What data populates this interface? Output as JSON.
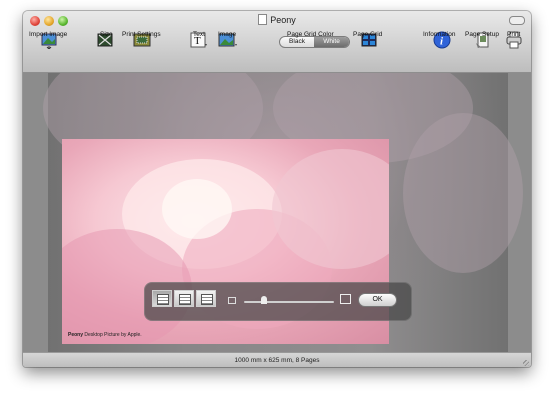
{
  "window": {
    "title": "Peony"
  },
  "toolbar": {
    "import_image": "Import Image",
    "size": "Size",
    "print_settings": "Print Settings",
    "text": "Text",
    "image": "Image",
    "page_grid_color": "Page Grid Color",
    "page_grid_color_options": [
      "Black",
      "White"
    ],
    "page_grid_color_selected": "White",
    "page_grid": "Page Grid",
    "information": "Information",
    "page_setup": "Page Setup",
    "print": "Print"
  },
  "photo": {
    "caption_name": "Peony",
    "caption_text": "Desktop Picture by Apple."
  },
  "hud": {
    "ok_label": "OK",
    "layout_options": [
      "single page",
      "two columns",
      "stacked"
    ],
    "zoom_level": 0.2
  },
  "status": {
    "text": "1000 mm  x  625 mm, 8 Pages"
  },
  "colors": {
    "accent_info": "#2f63d8",
    "canvas_bg": "#8c8c8c"
  }
}
